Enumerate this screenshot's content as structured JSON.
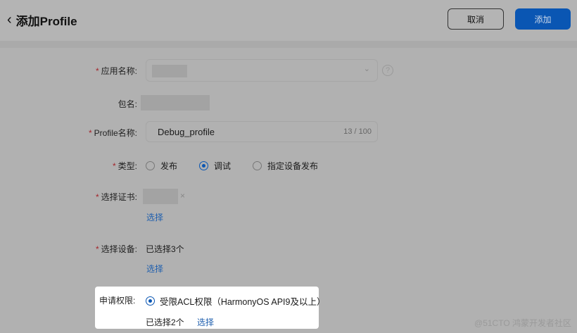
{
  "header": {
    "title": "添加Profile",
    "cancel_label": "取消",
    "add_label": "添加"
  },
  "form": {
    "app_name": {
      "label": "应用名称:",
      "required": true
    },
    "package": {
      "label": "包名:"
    },
    "profile_name": {
      "label": "Profile名称:",
      "value": "Debug_profile",
      "counter": "13 / 100"
    },
    "type": {
      "label": "类型:",
      "options": [
        "发布",
        "调试",
        "指定设备发布"
      ],
      "selected": "调试"
    },
    "cert": {
      "label": "选择证书:",
      "select_link": "选择"
    },
    "devices": {
      "label": "选择设备:",
      "status": "已选择3个",
      "select_link": "选择"
    },
    "permissions": {
      "label": "申请权限:",
      "option": "受限ACL权限（HarmonyOS API9及以上）",
      "status": "已选择2个",
      "select_link": "选择"
    }
  },
  "watermark": "@51CTO 鸿蒙开发者社区",
  "colors": {
    "accent": "#0a56b3",
    "required": "#a4262c"
  }
}
